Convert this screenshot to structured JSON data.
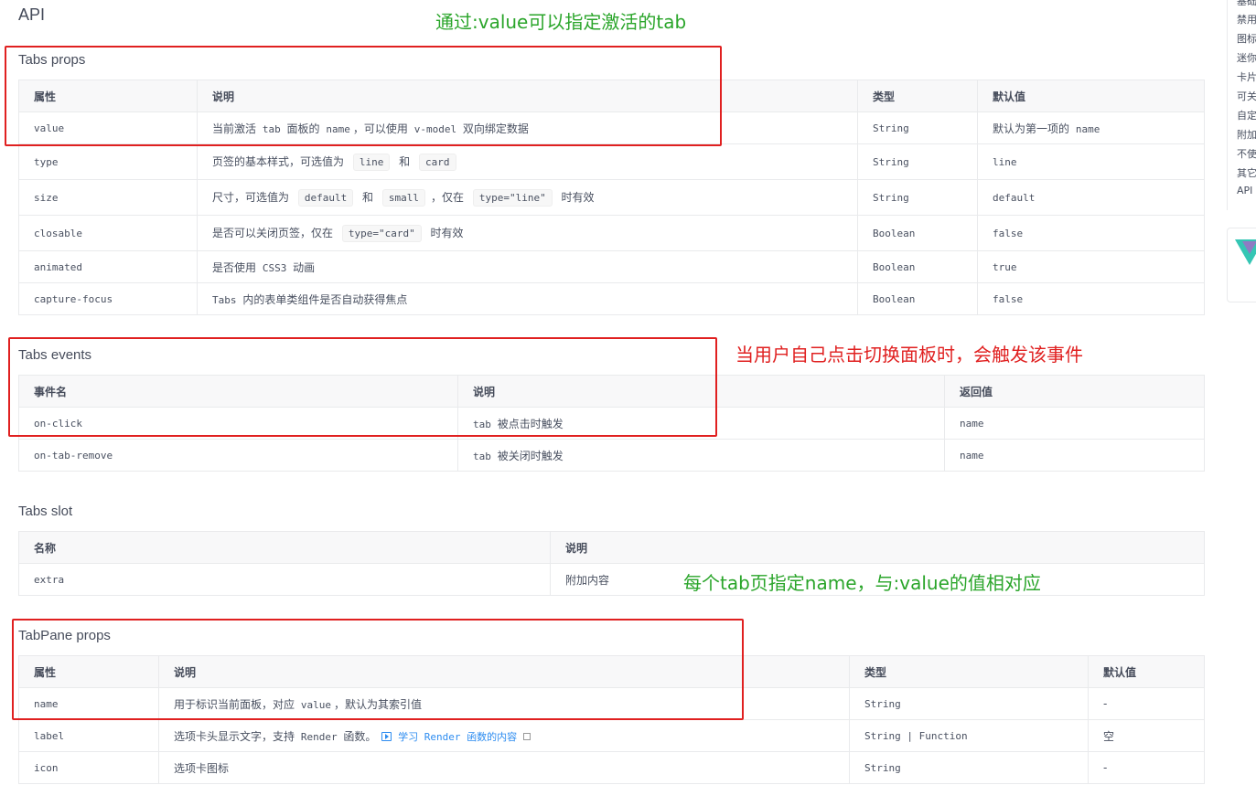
{
  "page": {
    "title": "API"
  },
  "tabs_props": {
    "title": "Tabs props",
    "headers": [
      "属性",
      "说明",
      "类型",
      "默认值"
    ],
    "rows": [
      {
        "name": "value",
        "desc": [
          "当前激活",
          "tab",
          "面板的",
          "name",
          "，可以使用",
          "v-model",
          "双向绑定数据"
        ],
        "type": "String",
        "default": [
          "默认为第一项的",
          "name"
        ]
      },
      {
        "name": "type",
        "desc": [
          "页签的基本样式，可选值为",
          "line",
          "和",
          "card"
        ],
        "type": "String",
        "default": "line"
      },
      {
        "name": "size",
        "desc": [
          "尺寸，可选值为",
          "default",
          "和",
          "small",
          "，仅在",
          "type=\"line\"",
          "时有效"
        ],
        "type": "String",
        "default": "default"
      },
      {
        "name": "closable",
        "desc": [
          "是否可以关闭页签，仅在",
          "type=\"card\"",
          "时有效"
        ],
        "type": "Boolean",
        "default": "false"
      },
      {
        "name": "animated",
        "desc": [
          "是否使用",
          "CSS3",
          "动画"
        ],
        "type": "Boolean",
        "default": "true"
      },
      {
        "name": "capture-focus",
        "desc": [
          "Tabs",
          "内的表单类组件是否自动获得焦点"
        ],
        "type": "Boolean",
        "default": "false"
      }
    ]
  },
  "tabs_events": {
    "title": "Tabs events",
    "headers": [
      "事件名",
      "说明",
      "返回值"
    ],
    "rows": [
      {
        "name": "on-click",
        "desc": [
          "tab",
          "被点击时触发"
        ],
        "ret": "name"
      },
      {
        "name": "on-tab-remove",
        "desc": [
          "tab",
          "被关闭时触发"
        ],
        "ret": "name"
      }
    ]
  },
  "tabs_slot": {
    "title": "Tabs slot",
    "headers": [
      "名称",
      "说明"
    ],
    "rows": [
      {
        "name": "extra",
        "desc": "附加内容"
      }
    ]
  },
  "tabpane_props": {
    "title": "TabPane props",
    "headers": [
      "属性",
      "说明",
      "类型",
      "默认值"
    ],
    "rows": [
      {
        "name": "name",
        "desc": [
          "用于标识当前面板，对应",
          "value",
          "，默认为其索引值"
        ],
        "type": "String",
        "default": "-"
      },
      {
        "name": "label",
        "desc": [
          "选项卡头显示文字，支持",
          "Render",
          "函数。"
        ],
        "link": "学习 Render 函数的内容",
        "type": "String | Function",
        "default": "空"
      },
      {
        "name": "icon",
        "desc": [
          "选项卡图标"
        ],
        "type": "String",
        "default": "-"
      }
    ]
  },
  "annotations": {
    "value_note": "通过:value可以指定激活的tab",
    "events_note": "当用户自己点击切换面板时，会触发该事件",
    "name_note": "每个tab页指定name，与:value的值相对应",
    "color_green": "#2aa52a",
    "color_red": "#e02020"
  },
  "right_nav": {
    "items": [
      "基础",
      "禁用",
      "图标",
      "迷你",
      "卡片",
      "可关",
      "自定",
      "附加",
      "不使",
      "其它",
      "API"
    ]
  }
}
